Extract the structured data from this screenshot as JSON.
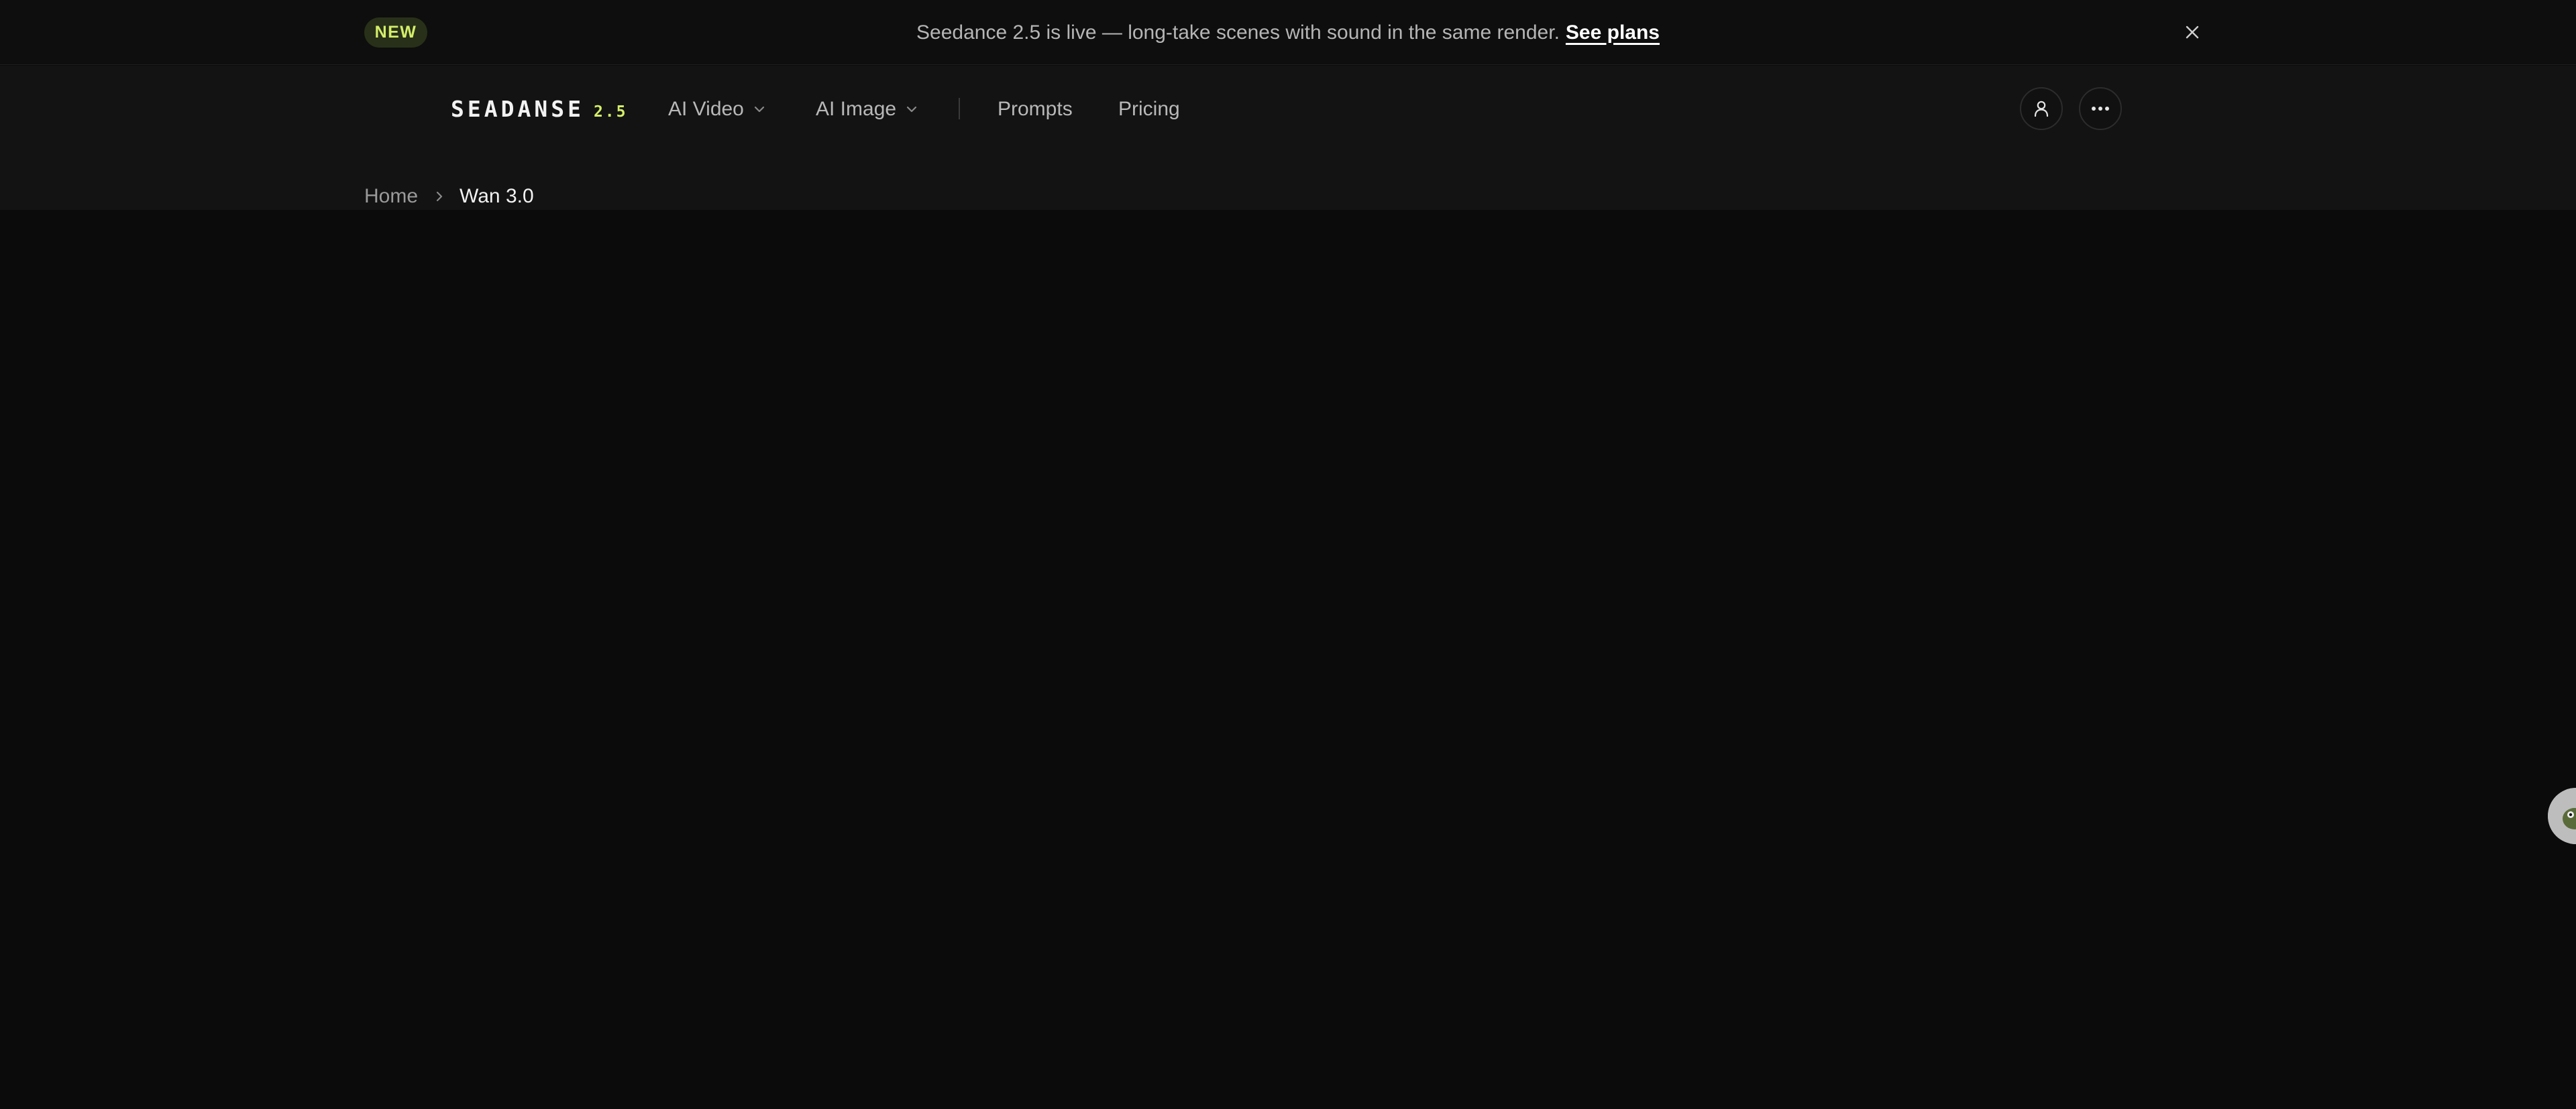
{
  "announcement": {
    "badge": "NEW",
    "message": "Seedance 2.5 is live — long-take scenes with sound in the same render.",
    "link": "See plans",
    "close_icon": "close-icon"
  },
  "nav": {
    "logo_text": "SEADANSE",
    "logo_version": "2.5",
    "items": [
      {
        "label": "AI Video",
        "has_dropdown": true
      },
      {
        "label": "AI Image",
        "has_dropdown": true
      },
      {
        "label": "Prompts",
        "has_dropdown": false
      },
      {
        "label": "Pricing",
        "has_dropdown": false
      }
    ],
    "icons": [
      "user-icon",
      "more-icon"
    ]
  },
  "breadcrumb": {
    "home": "Home",
    "current": "Wan 3.0",
    "separator_icon": "chevron-right-icon"
  },
  "floating": {
    "icon": "chat-assistant-icon"
  },
  "colors": {
    "accent": "#d4ee6a",
    "background": "#0b0b0b",
    "navbar": "#131313"
  }
}
